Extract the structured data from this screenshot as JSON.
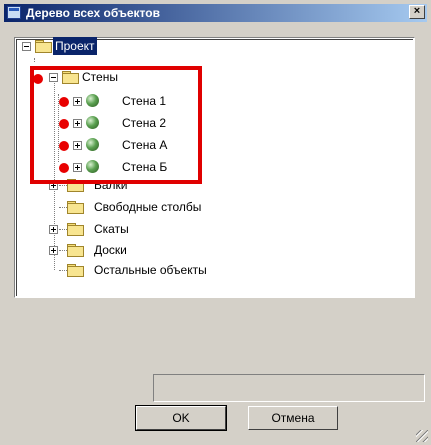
{
  "window": {
    "title": "Дерево всех объектов",
    "close_glyph": "×"
  },
  "tree": {
    "root": {
      "label": "Проект",
      "icon": "folder-open-icon"
    },
    "walls": {
      "label": "Стены",
      "icon": "folder-open-icon",
      "children": [
        {
          "label": "Стена 1",
          "icon": "green-ball-icon"
        },
        {
          "label": "Стена 2",
          "icon": "green-ball-icon"
        },
        {
          "label": "Стена А",
          "icon": "green-ball-icon"
        },
        {
          "label": "Стена Б",
          "icon": "green-ball-icon"
        }
      ]
    },
    "others": [
      {
        "label": "Балки",
        "icon": "folder-icon",
        "expandable": true
      },
      {
        "label": "Свободные столбы",
        "icon": "folder-icon",
        "expandable": false
      },
      {
        "label": "Скаты",
        "icon": "folder-icon",
        "expandable": true
      },
      {
        "label": "Доски",
        "icon": "folder-icon",
        "expandable": true
      },
      {
        "label": "Остальные объекты",
        "icon": "folder-icon",
        "expandable": false
      }
    ]
  },
  "annotation": {
    "marker_color": "#e80000",
    "box_color": "#e00000"
  },
  "buttons": {
    "ok": "OK",
    "cancel": "Отмена"
  },
  "colors": {
    "title_gradient_start": "#0a246a",
    "title_gradient_end": "#a6caf0",
    "selection": "#0a246a",
    "dialog_bg": "#d4d0c8"
  }
}
